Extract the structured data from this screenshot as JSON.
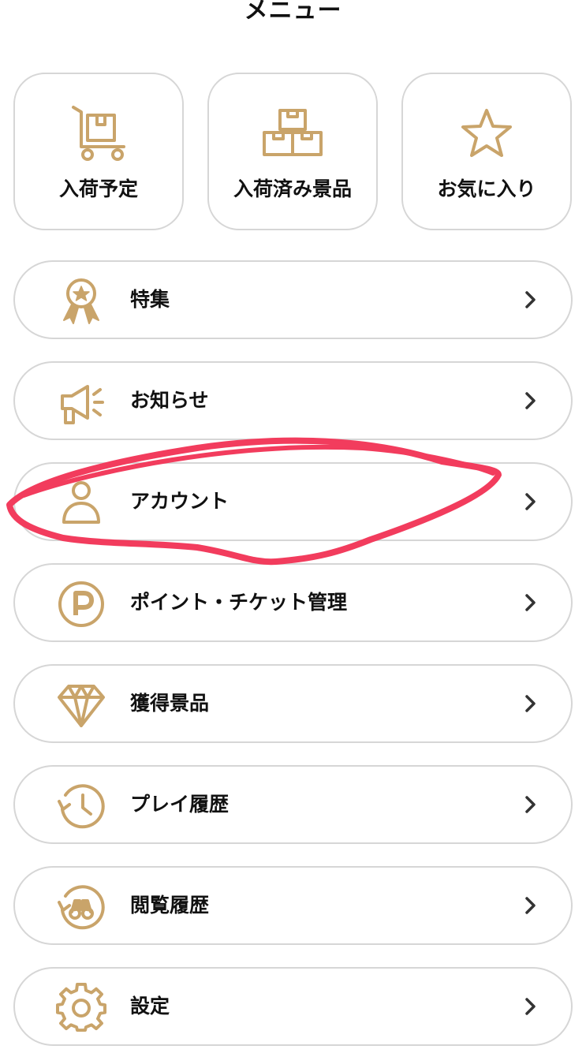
{
  "header": {
    "title": "メニュー"
  },
  "colors": {
    "accent": "#c9a46a",
    "border": "#d6d6d6",
    "text": "#111111",
    "chevron": "#333333",
    "annotation": "#f23c5d"
  },
  "tiles": [
    {
      "label": "入荷予定",
      "icon": "cart-with-box-icon"
    },
    {
      "label": "入荷済み景品",
      "icon": "stacked-boxes-icon"
    },
    {
      "label": "お気に入り",
      "icon": "star-icon"
    }
  ],
  "menu": {
    "items": [
      {
        "label": "特集",
        "icon": "award-badge-icon"
      },
      {
        "label": "お知らせ",
        "icon": "megaphone-icon"
      },
      {
        "label": "アカウント",
        "icon": "user-icon"
      },
      {
        "label": "ポイント・チケット管理",
        "icon": "point-p-icon"
      },
      {
        "label": "獲得景品",
        "icon": "diamond-icon"
      },
      {
        "label": "プレイ履歴",
        "icon": "clock-history-icon"
      },
      {
        "label": "閲覧履歴",
        "icon": "binoculars-history-icon"
      },
      {
        "label": "設定",
        "icon": "gear-icon"
      }
    ]
  }
}
